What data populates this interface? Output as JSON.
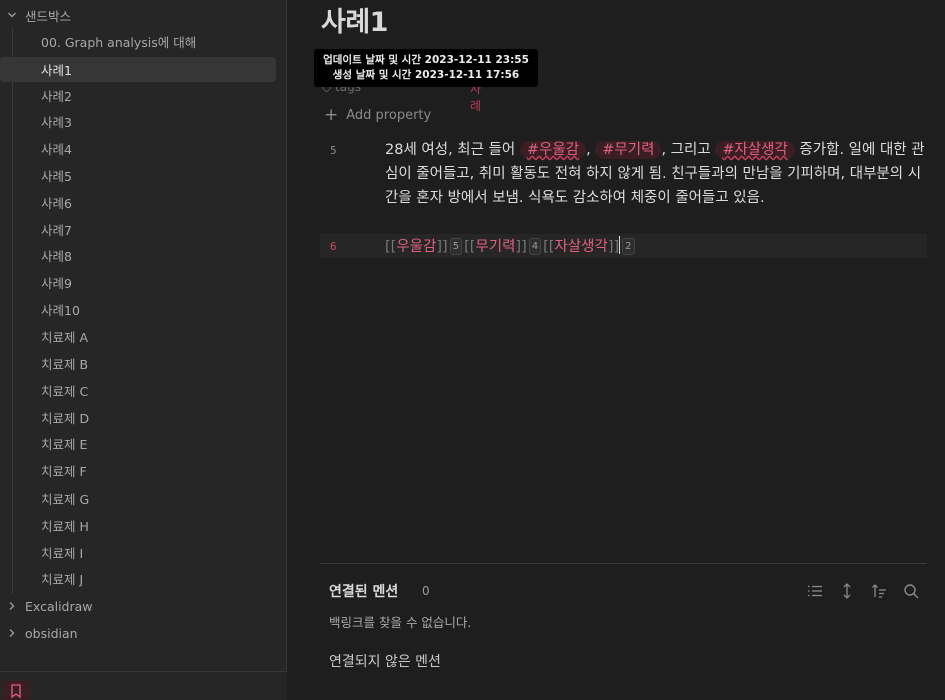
{
  "sidebar": {
    "folders": [
      {
        "label": "샌드박스",
        "expanded": true
      },
      {
        "label": "Excalidraw",
        "expanded": false
      },
      {
        "label": "obsidian",
        "expanded": false
      }
    ],
    "files": [
      "00. Graph analysis에 대해",
      "사례1",
      "사례2",
      "사례3",
      "사례4",
      "사례5",
      "사례6",
      "사례7",
      "사례8",
      "사례9",
      "사례10",
      "치료제 A",
      "치료제 B",
      "치료제 C",
      "치료제 D",
      "치료제 E",
      "치료제 F",
      "치료제 G",
      "치료제 H",
      "치료제 I",
      "치료제 J"
    ],
    "active_file": "사례1"
  },
  "note": {
    "title": "사례1",
    "tooltip": {
      "updated": "업데이트 날짜 및 시간 2023-12-11 23:55",
      "created": "생성 날짜 및 시간 2023-12-11 17:56"
    },
    "property_tags_label": "tags",
    "property_tags_value": "사례",
    "add_property": "Add property",
    "line5_num": "5",
    "line6_num": "6",
    "para": {
      "p1": "28세 여성, 최근 들어 ",
      "tag1": "#우울감",
      "sep1": ", ",
      "tag2": "#무기력",
      "sep2": ", 그리고 ",
      "tag3": "#자살생각",
      "p2": " 증가함. 일에 대한 관심이 줄어들고, 취미 활동도 전혀 하지 않게 됨. 친구들과의 만남을 기피하며, 대부분의 시간을 혼자 방에서 보냄. 식욕도 감소하여 체중이 줄어들고 있음."
    },
    "links": [
      {
        "open": "[[",
        "text": "우울감",
        "close": "]]",
        "count": "5"
      },
      {
        "open": "[[",
        "text": "무기력",
        "close": "]]",
        "count": "4"
      },
      {
        "open": "[[",
        "text": "자살생각",
        "close": "]]",
        "count": "2"
      }
    ]
  },
  "backlinks": {
    "title": "연결된 멘션",
    "count": "0",
    "empty_message": "백링크를 찾을 수 없습니다.",
    "unlinked_title": "연결되지 않은 멘션"
  },
  "colors": {
    "accent": "#e06080",
    "tag_bg": "#3a1e24",
    "sidebar_bg": "#262626",
    "main_bg": "#1e1e1e"
  }
}
